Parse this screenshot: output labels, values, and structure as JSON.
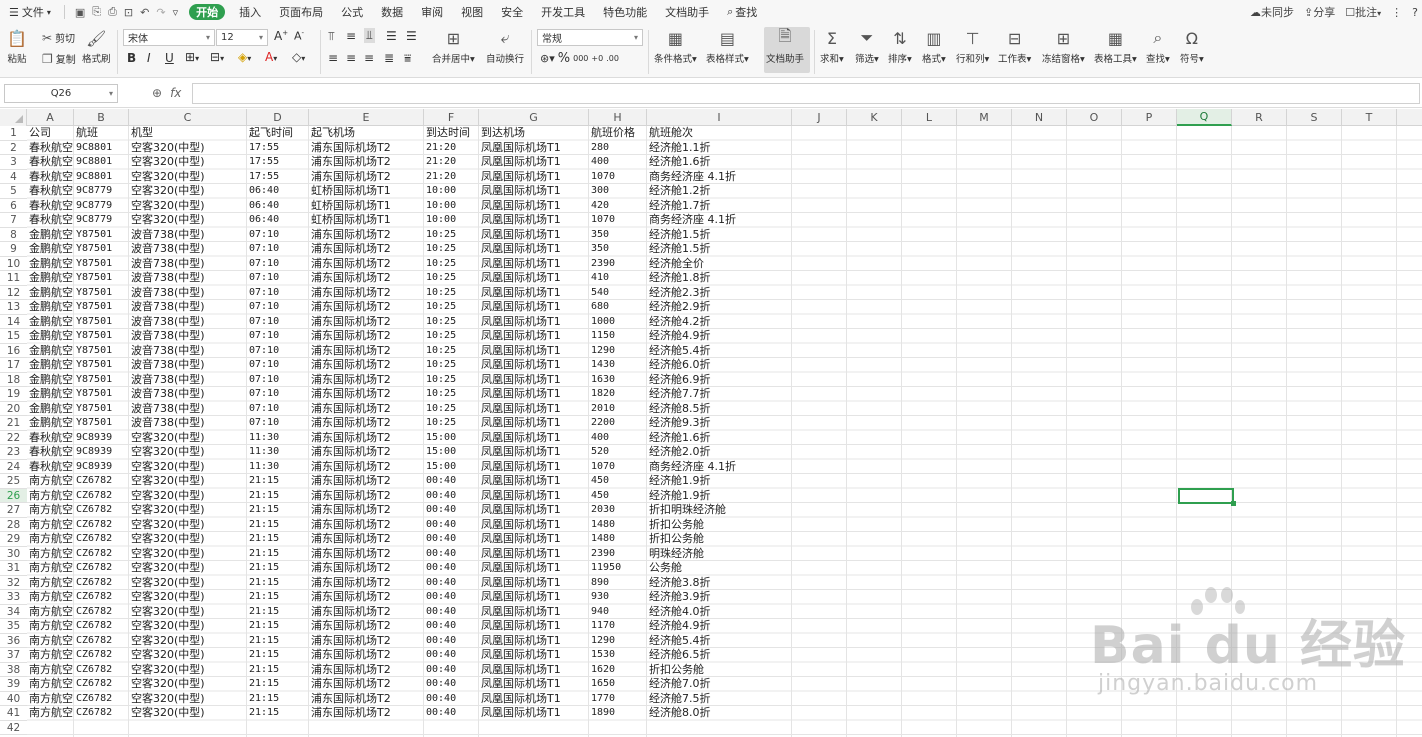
{
  "menu": {
    "file": "文件",
    "items": [
      "开始",
      "插入",
      "页面布局",
      "公式",
      "数据",
      "审阅",
      "视图",
      "安全",
      "开发工具",
      "特色功能",
      "文档助手"
    ],
    "search": "查找",
    "right": [
      "未同步",
      "分享",
      "批注"
    ]
  },
  "ribbon": {
    "paste": "粘贴",
    "cut": "剪切",
    "copy": "复制",
    "format_painter": "格式刷",
    "font_name": "宋体",
    "font_size": "12",
    "merge_center": "合并居中",
    "auto_wrap": "自动换行",
    "number_format": "常规",
    "cond_format": "条件格式",
    "table_style": "表格样式",
    "doc_assistant": "文档助手",
    "sum": "求和",
    "filter": "筛选",
    "sort": "排序",
    "format": "格式",
    "row_col": "行和列",
    "worksheet": "工作表",
    "freeze": "冻结窗格",
    "table_tools": "表格工具",
    "find": "查找",
    "symbol": "符号"
  },
  "formula_bar": {
    "name_box": "Q26",
    "fx": "fx",
    "value": ""
  },
  "columns": [
    "A",
    "B",
    "C",
    "D",
    "E",
    "F",
    "G",
    "H",
    "I",
    "J",
    "K",
    "L",
    "M",
    "N",
    "O",
    "P",
    "Q",
    "R",
    "S",
    "T"
  ],
  "selected_column": "Q",
  "selected_row": 26,
  "headers": [
    "公司",
    "航班",
    "机型",
    "起飞时间",
    "起飞机场",
    "到达时间",
    "到达机场",
    "航班价格",
    "航班舱次"
  ],
  "rows": [
    [
      "春秋航空",
      "9C8801",
      "空客320(中型)",
      "17:55",
      "浦东国际机场T2",
      "21:20",
      "凤凰国际机场T1",
      "280",
      "经济舱1.1折"
    ],
    [
      "春秋航空",
      "9C8801",
      "空客320(中型)",
      "17:55",
      "浦东国际机场T2",
      "21:20",
      "凤凰国际机场T1",
      "400",
      "经济舱1.6折"
    ],
    [
      "春秋航空",
      "9C8801",
      "空客320(中型)",
      "17:55",
      "浦东国际机场T2",
      "21:20",
      "凤凰国际机场T1",
      "1070",
      "商务经济座 4.1折"
    ],
    [
      "春秋航空",
      "9C8779",
      "空客320(中型)",
      "06:40",
      "虹桥国际机场T1",
      "10:00",
      "凤凰国际机场T1",
      "300",
      "经济舱1.2折"
    ],
    [
      "春秋航空",
      "9C8779",
      "空客320(中型)",
      "06:40",
      "虹桥国际机场T1",
      "10:00",
      "凤凰国际机场T1",
      "420",
      "经济舱1.7折"
    ],
    [
      "春秋航空",
      "9C8779",
      "空客320(中型)",
      "06:40",
      "虹桥国际机场T1",
      "10:00",
      "凤凰国际机场T1",
      "1070",
      "商务经济座 4.1折"
    ],
    [
      "金鹏航空",
      "Y87501",
      "波音738(中型)",
      "07:10",
      "浦东国际机场T2",
      "10:25",
      "凤凰国际机场T1",
      "350",
      "经济舱1.5折"
    ],
    [
      "金鹏航空",
      "Y87501",
      "波音738(中型)",
      "07:10",
      "浦东国际机场T2",
      "10:25",
      "凤凰国际机场T1",
      "350",
      "经济舱1.5折"
    ],
    [
      "金鹏航空",
      "Y87501",
      "波音738(中型)",
      "07:10",
      "浦东国际机场T2",
      "10:25",
      "凤凰国际机场T1",
      "2390",
      "经济舱全价"
    ],
    [
      "金鹏航空",
      "Y87501",
      "波音738(中型)",
      "07:10",
      "浦东国际机场T2",
      "10:25",
      "凤凰国际机场T1",
      "410",
      "经济舱1.8折"
    ],
    [
      "金鹏航空",
      "Y87501",
      "波音738(中型)",
      "07:10",
      "浦东国际机场T2",
      "10:25",
      "凤凰国际机场T1",
      "540",
      "经济舱2.3折"
    ],
    [
      "金鹏航空",
      "Y87501",
      "波音738(中型)",
      "07:10",
      "浦东国际机场T2",
      "10:25",
      "凤凰国际机场T1",
      "680",
      "经济舱2.9折"
    ],
    [
      "金鹏航空",
      "Y87501",
      "波音738(中型)",
      "07:10",
      "浦东国际机场T2",
      "10:25",
      "凤凰国际机场T1",
      "1000",
      "经济舱4.2折"
    ],
    [
      "金鹏航空",
      "Y87501",
      "波音738(中型)",
      "07:10",
      "浦东国际机场T2",
      "10:25",
      "凤凰国际机场T1",
      "1150",
      "经济舱4.9折"
    ],
    [
      "金鹏航空",
      "Y87501",
      "波音738(中型)",
      "07:10",
      "浦东国际机场T2",
      "10:25",
      "凤凰国际机场T1",
      "1290",
      "经济舱5.4折"
    ],
    [
      "金鹏航空",
      "Y87501",
      "波音738(中型)",
      "07:10",
      "浦东国际机场T2",
      "10:25",
      "凤凰国际机场T1",
      "1430",
      "经济舱6.0折"
    ],
    [
      "金鹏航空",
      "Y87501",
      "波音738(中型)",
      "07:10",
      "浦东国际机场T2",
      "10:25",
      "凤凰国际机场T1",
      "1630",
      "经济舱6.9折"
    ],
    [
      "金鹏航空",
      "Y87501",
      "波音738(中型)",
      "07:10",
      "浦东国际机场T2",
      "10:25",
      "凤凰国际机场T1",
      "1820",
      "经济舱7.7折"
    ],
    [
      "金鹏航空",
      "Y87501",
      "波音738(中型)",
      "07:10",
      "浦东国际机场T2",
      "10:25",
      "凤凰国际机场T1",
      "2010",
      "经济舱8.5折"
    ],
    [
      "金鹏航空",
      "Y87501",
      "波音738(中型)",
      "07:10",
      "浦东国际机场T2",
      "10:25",
      "凤凰国际机场T1",
      "2200",
      "经济舱9.3折"
    ],
    [
      "春秋航空",
      "9C8939",
      "空客320(中型)",
      "11:30",
      "浦东国际机场T2",
      "15:00",
      "凤凰国际机场T1",
      "400",
      "经济舱1.6折"
    ],
    [
      "春秋航空",
      "9C8939",
      "空客320(中型)",
      "11:30",
      "浦东国际机场T2",
      "15:00",
      "凤凰国际机场T1",
      "520",
      "经济舱2.0折"
    ],
    [
      "春秋航空",
      "9C8939",
      "空客320(中型)",
      "11:30",
      "浦东国际机场T2",
      "15:00",
      "凤凰国际机场T1",
      "1070",
      "商务经济座 4.1折"
    ],
    [
      "南方航空",
      "CZ6782",
      "空客320(中型)",
      "21:15",
      "浦东国际机场T2",
      "00:40",
      "凤凰国际机场T1",
      "450",
      "经济舱1.9折"
    ],
    [
      "南方航空",
      "CZ6782",
      "空客320(中型)",
      "21:15",
      "浦东国际机场T2",
      "00:40",
      "凤凰国际机场T1",
      "450",
      "经济舱1.9折"
    ],
    [
      "南方航空",
      "CZ6782",
      "空客320(中型)",
      "21:15",
      "浦东国际机场T2",
      "00:40",
      "凤凰国际机场T1",
      "2030",
      "折扣明珠经济舱"
    ],
    [
      "南方航空",
      "CZ6782",
      "空客320(中型)",
      "21:15",
      "浦东国际机场T2",
      "00:40",
      "凤凰国际机场T1",
      "1480",
      "折扣公务舱"
    ],
    [
      "南方航空",
      "CZ6782",
      "空客320(中型)",
      "21:15",
      "浦东国际机场T2",
      "00:40",
      "凤凰国际机场T1",
      "1480",
      "折扣公务舱"
    ],
    [
      "南方航空",
      "CZ6782",
      "空客320(中型)",
      "21:15",
      "浦东国际机场T2",
      "00:40",
      "凤凰国际机场T1",
      "2390",
      "明珠经济舱"
    ],
    [
      "南方航空",
      "CZ6782",
      "空客320(中型)",
      "21:15",
      "浦东国际机场T2",
      "00:40",
      "凤凰国际机场T1",
      "11950",
      "公务舱"
    ],
    [
      "南方航空",
      "CZ6782",
      "空客320(中型)",
      "21:15",
      "浦东国际机场T2",
      "00:40",
      "凤凰国际机场T1",
      "890",
      "经济舱3.8折"
    ],
    [
      "南方航空",
      "CZ6782",
      "空客320(中型)",
      "21:15",
      "浦东国际机场T2",
      "00:40",
      "凤凰国际机场T1",
      "930",
      "经济舱3.9折"
    ],
    [
      "南方航空",
      "CZ6782",
      "空客320(中型)",
      "21:15",
      "浦东国际机场T2",
      "00:40",
      "凤凰国际机场T1",
      "940",
      "经济舱4.0折"
    ],
    [
      "南方航空",
      "CZ6782",
      "空客320(中型)",
      "21:15",
      "浦东国际机场T2",
      "00:40",
      "凤凰国际机场T1",
      "1170",
      "经济舱4.9折"
    ],
    [
      "南方航空",
      "CZ6782",
      "空客320(中型)",
      "21:15",
      "浦东国际机场T2",
      "00:40",
      "凤凰国际机场T1",
      "1290",
      "经济舱5.4折"
    ],
    [
      "南方航空",
      "CZ6782",
      "空客320(中型)",
      "21:15",
      "浦东国际机场T2",
      "00:40",
      "凤凰国际机场T1",
      "1530",
      "经济舱6.5折"
    ],
    [
      "南方航空",
      "CZ6782",
      "空客320(中型)",
      "21:15",
      "浦东国际机场T2",
      "00:40",
      "凤凰国际机场T1",
      "1620",
      "折扣公务舱"
    ],
    [
      "南方航空",
      "CZ6782",
      "空客320(中型)",
      "21:15",
      "浦东国际机场T2",
      "00:40",
      "凤凰国际机场T1",
      "1650",
      "经济舱7.0折"
    ],
    [
      "南方航空",
      "CZ6782",
      "空客320(中型)",
      "21:15",
      "浦东国际机场T2",
      "00:40",
      "凤凰国际机场T1",
      "1770",
      "经济舱7.5折"
    ],
    [
      "南方航空",
      "CZ6782",
      "空客320(中型)",
      "21:15",
      "浦东国际机场T2",
      "00:40",
      "凤凰国际机场T1",
      "1890",
      "经济舱8.0折"
    ]
  ],
  "watermark": {
    "brand": "Bai du 经验",
    "url": "jingyan.baidu.com"
  },
  "colors": {
    "accent": "#2f9f4f"
  }
}
